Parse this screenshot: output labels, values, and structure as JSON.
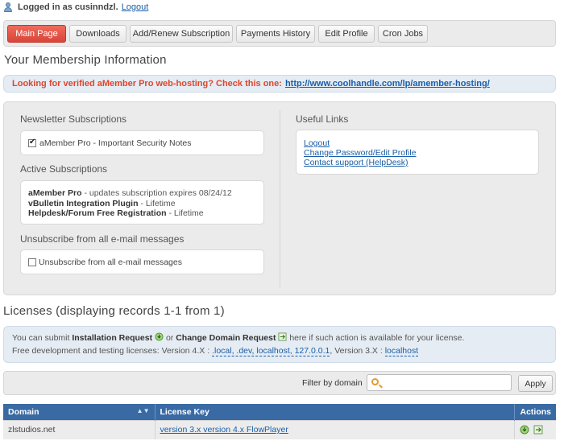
{
  "user": {
    "logged_text": "Logged in as cusinndzl.",
    "logout_label": "Logout"
  },
  "tabs": [
    {
      "label": "Main Page",
      "active": true
    },
    {
      "label": "Downloads"
    },
    {
      "label": "Add/Renew Subscription"
    },
    {
      "label": "Payments History"
    },
    {
      "label": "Edit Profile"
    },
    {
      "label": "Cron Jobs"
    }
  ],
  "page_title": "Your Membership Information",
  "notice": {
    "text": "Looking for verified aMember Pro web-hosting? Check this one:",
    "link": "http://www.coolhandle.com/lp/amember-hosting/"
  },
  "newsletter": {
    "title": "Newsletter Subscriptions",
    "item": "aMember Pro - Important Security Notes",
    "checked": true
  },
  "active_subscriptions": {
    "title": "Active Subscriptions",
    "items": [
      {
        "name": "aMember Pro",
        "detail": " - updates subscription expires 08/24/12"
      },
      {
        "name": "vBulletin Integration Plugin",
        "detail": " - Lifetime"
      },
      {
        "name": "Helpdesk/Forum Free Registration",
        "detail": " - Lifetime"
      }
    ]
  },
  "unsubscribe": {
    "title": "Unsubscribe from all e-mail messages",
    "label": "Unsubscribe from all e-mail messages",
    "checked": false
  },
  "useful_links": {
    "title": "Useful Links",
    "links": [
      "Logout",
      "Change Password/Edit Profile",
      "Contact support (HelpDesk)"
    ]
  },
  "licenses": {
    "title": "Licenses (displaying records 1-1 from 1)",
    "info": {
      "line1_prefix": "You can submit ",
      "install_request": "Installation Request",
      "or": " or ",
      "change_domain": "Change Domain Request",
      "line1_suffix": " here if such action is available for your license.",
      "line2_prefix": "Free development and testing licenses: Version 4.X : ",
      "v4_domains": ".local, .dev, localhost, 127.0.0.1",
      "line2_mid": ", Version 3.X : ",
      "v3_domains": "localhost"
    },
    "filter_label": "Filter by domain",
    "filter_placeholder": "",
    "apply_label": "Apply",
    "columns": [
      "Domain",
      "License Key",
      "Actions"
    ],
    "rows": [
      {
        "domain": "zlstudios.net",
        "key": "version 3.x version 4.x FlowPlayer"
      }
    ]
  },
  "colors": {
    "accent": "#d9453a",
    "link": "#1a5ea8",
    "table_header": "#3a6aa4",
    "notice": "#e0452c"
  }
}
